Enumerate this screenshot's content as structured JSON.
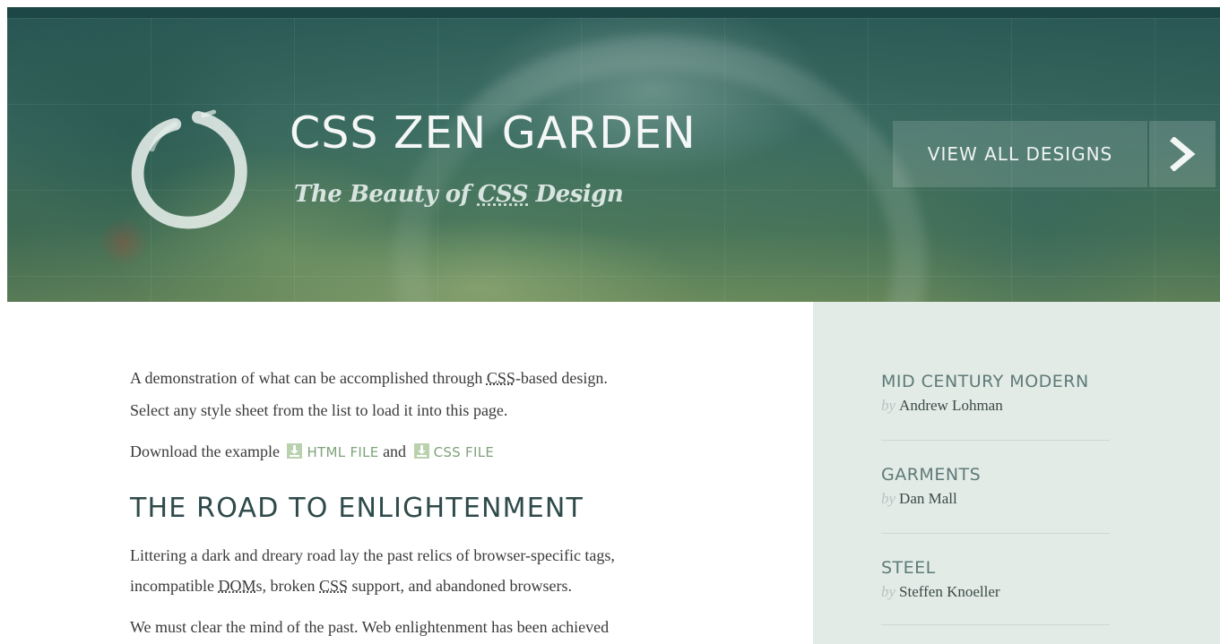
{
  "header": {
    "title": "CSS ZEN GARDEN",
    "tagline_prefix": "The Beauty of ",
    "tagline_abbr": "CSS",
    "tagline_suffix": " Design",
    "view_all_label": "VIEW ALL DESIGNS"
  },
  "intro": {
    "line1_prefix": "A demonstration of what can be accomplished through ",
    "line1_abbr": "CSS",
    "line1_suffix": "-based design.",
    "line2": "Select any style sheet from the list to load it into this page.",
    "download_prefix": "Download the example",
    "html_file_label": "HTML FILE",
    "and_text": "and",
    "css_file_label": "CSS FILE"
  },
  "road": {
    "heading": "THE ROAD TO ENLIGHTENMENT",
    "p1_line1": "Littering a dark and dreary road lay the past relics of browser-specific tags,",
    "p1_line2_prefix": "incompatible ",
    "p1_line2_abbr1": "DOM",
    "p1_line2_mid": "s, broken ",
    "p1_line2_abbr2": "CSS",
    "p1_line2_suffix": " support, and abandoned browsers.",
    "p2_line1": "We must clear the mind of the past. Web enlightenment has been achieved"
  },
  "sidebar": {
    "by_label": "by",
    "designs": [
      {
        "name": "MID CENTURY MODERN",
        "author": "Andrew Lohman"
      },
      {
        "name": "GARMENTS",
        "author": "Dan Mall"
      },
      {
        "name": "STEEL",
        "author": "Steffen Knoeller"
      }
    ]
  },
  "colors": {
    "header_accent": "#1d4646",
    "sidebar_bg": "#e2ebe6",
    "link_green": "#7fa37a"
  },
  "icons": {
    "logo": "enso-circle-icon",
    "next": "chevron-right-icon",
    "download": "download-icon"
  }
}
